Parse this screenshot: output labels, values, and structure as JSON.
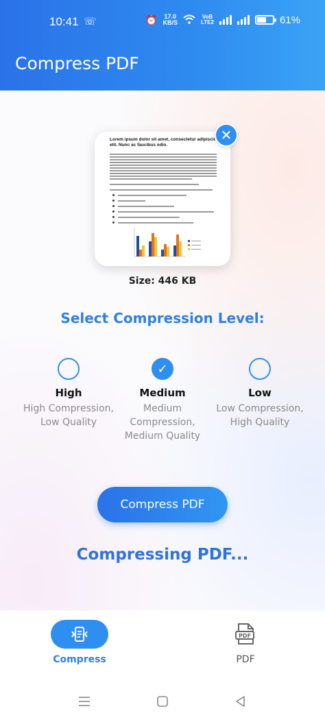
{
  "status_bar": {
    "time": "10:41",
    "network_speed": "17.0",
    "network_speed_unit": "KB/S",
    "network_type_top": "VoB",
    "network_type_bottom": "LTE2",
    "battery_percent": "61%",
    "battery_level": 0.61
  },
  "app_bar": {
    "title": "Compress PDF"
  },
  "preview": {
    "doc_heading": "Lorem ipsum dolor sit amet, consectetur adipiscing elit. Nunc ac faucibus odio.",
    "size_label": "Size: 446 KB",
    "close_icon": "close-icon"
  },
  "compression": {
    "title": "Select Compression Level:",
    "options": [
      {
        "label": "High",
        "description": "High Compression, Low Quality",
        "selected": false
      },
      {
        "label": "Medium",
        "description": "Medium Compression, Medium Quality",
        "selected": true
      },
      {
        "label": "Low",
        "description": "Low Compression, High Quality",
        "selected": false
      }
    ]
  },
  "compress_button": {
    "label": "Compress PDF"
  },
  "progress_text": "Compressing PDF...",
  "bottom_nav": {
    "items": [
      {
        "label": "Compress",
        "icon": "compress-icon",
        "active": true
      },
      {
        "label": "PDF",
        "icon": "pdf-file-icon",
        "active": false
      }
    ]
  },
  "colors": {
    "primary": "#2f8ff0",
    "primary_dark": "#2a72e8",
    "text_muted": "#8a8a8a"
  }
}
